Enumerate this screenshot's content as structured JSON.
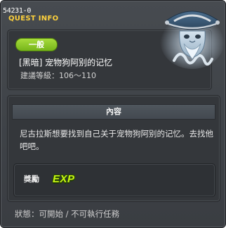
{
  "window": {
    "quest_id": "54231-0",
    "header_label": "QUEST INFO"
  },
  "quest": {
    "category": "一般",
    "title": "[黑暗] 宠物狗阿别的记忆",
    "level_text": "建議等級：106～110"
  },
  "content": {
    "section_title": "內容",
    "description": "尼古拉斯想要找到自己关于宠物狗阿别的记忆。去找他吧吧。"
  },
  "reward": {
    "label": "獎勵",
    "items": [
      {
        "icon": "exp-icon",
        "text": "EXP"
      }
    ]
  },
  "status": {
    "text": "狀態：可開始 / 不可執行任務"
  },
  "npc": {
    "icon": "npc-ghost-portrait"
  },
  "colors": {
    "header_label": "#ffd23c",
    "category_badge": "#8bc926",
    "exp_icon": "#c7f514",
    "window_bg": "#43474c"
  }
}
